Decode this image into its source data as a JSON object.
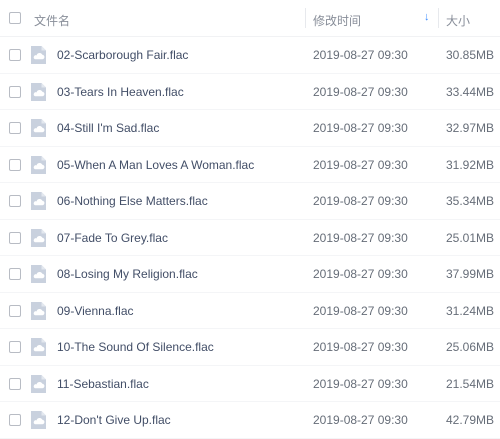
{
  "header": {
    "name_label": "文件名",
    "time_label": "修改时间",
    "sort_icon": "arrow-down-icon",
    "size_label": "大小"
  },
  "colors": {
    "sort_arrow": "#3b8cff",
    "file_icon": "#c9d1de",
    "text": "#424e67"
  },
  "files": [
    {
      "name": "02-Scarborough Fair.flac",
      "modified": "2019-08-27 09:30",
      "size": "30.85MB"
    },
    {
      "name": "03-Tears In Heaven.flac",
      "modified": "2019-08-27 09:30",
      "size": "33.44MB"
    },
    {
      "name": "04-Still I'm Sad.flac",
      "modified": "2019-08-27 09:30",
      "size": "32.97MB"
    },
    {
      "name": "05-When A Man Loves A Woman.flac",
      "modified": "2019-08-27 09:30",
      "size": "31.92MB"
    },
    {
      "name": "06-Nothing Else Matters.flac",
      "modified": "2019-08-27 09:30",
      "size": "35.34MB"
    },
    {
      "name": "07-Fade To Grey.flac",
      "modified": "2019-08-27 09:30",
      "size": "25.01MB"
    },
    {
      "name": "08-Losing My Religion.flac",
      "modified": "2019-08-27 09:30",
      "size": "37.99MB"
    },
    {
      "name": "09-Vienna.flac",
      "modified": "2019-08-27 09:30",
      "size": "31.24MB"
    },
    {
      "name": "10-The Sound Of Silence.flac",
      "modified": "2019-08-27 09:30",
      "size": "25.06MB"
    },
    {
      "name": "11-Sebastian.flac",
      "modified": "2019-08-27 09:30",
      "size": "21.54MB"
    },
    {
      "name": "12-Don't Give Up.flac",
      "modified": "2019-08-27 09:30",
      "size": "42.79MB"
    }
  ]
}
